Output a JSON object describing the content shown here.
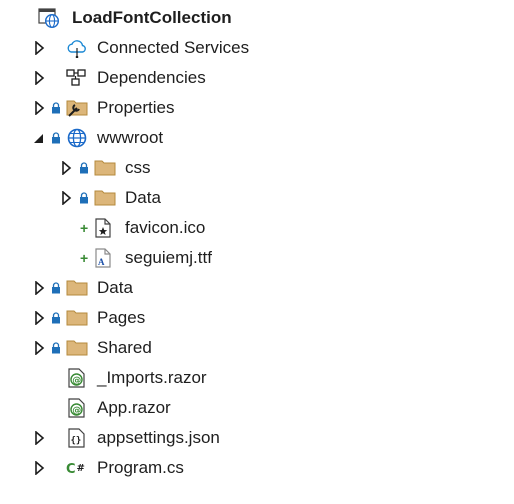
{
  "tree": {
    "root": {
      "label": "LoadFontCollection",
      "icon": "globe-project-icon"
    },
    "items": [
      {
        "label": "Connected Services",
        "icon": "cloud-connected-icon",
        "expander": "collapsed"
      },
      {
        "label": "Dependencies",
        "icon": "dependencies-icon",
        "expander": "collapsed"
      },
      {
        "label": "Properties",
        "icon": "properties-wrench-folder-icon",
        "expander": "collapsed",
        "locked": true
      },
      {
        "label": "wwwroot",
        "icon": "globe-icon",
        "expander": "expanded",
        "locked": true
      },
      {
        "label": "css",
        "icon": "folder-icon",
        "expander": "collapsed",
        "locked": true
      },
      {
        "label": "Data",
        "icon": "folder-icon",
        "expander": "collapsed",
        "locked": true
      },
      {
        "label": "favicon.ico",
        "icon": "ico-file-icon",
        "status": "added"
      },
      {
        "label": "seguiemj.ttf",
        "icon": "font-file-icon",
        "status": "added"
      },
      {
        "label": "Data",
        "icon": "folder-icon",
        "expander": "collapsed",
        "locked": true
      },
      {
        "label": "Pages",
        "icon": "folder-icon",
        "expander": "collapsed",
        "locked": true
      },
      {
        "label": "Shared",
        "icon": "folder-icon",
        "expander": "collapsed",
        "locked": true
      },
      {
        "label": "_Imports.razor",
        "icon": "razor-file-icon"
      },
      {
        "label": "App.razor",
        "icon": "razor-file-icon"
      },
      {
        "label": "appsettings.json",
        "icon": "json-file-icon",
        "expander": "collapsed"
      },
      {
        "label": "Program.cs",
        "icon": "csharp-file-icon",
        "expander": "collapsed"
      }
    ]
  },
  "colors": {
    "folder_fill": "#dcb67a",
    "folder_stroke": "#b58a3c",
    "lock": "#1e6fb8",
    "globe": "#1b6ac9",
    "added_plus": "#388a34",
    "razor": "#388a34"
  }
}
